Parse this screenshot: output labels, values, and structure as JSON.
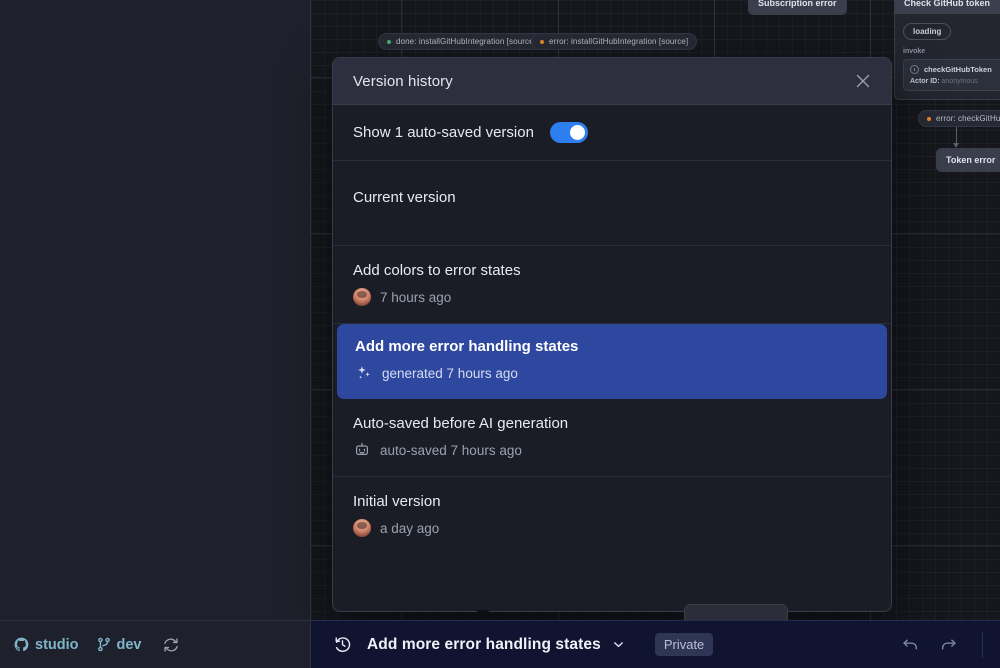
{
  "canvas": {
    "edge_pills": [
      {
        "label": "done:  installGitHubIntegration [source]",
        "status": "done"
      },
      {
        "label": "error:  installGitHubIntegration [source]",
        "status": "error"
      },
      {
        "label": "error:  checkGitHubToken",
        "status": "error"
      }
    ],
    "nodes": [
      {
        "title": "Subscription error"
      },
      {
        "title": "Check GitHub token",
        "state_chip": "loading",
        "invoke_label": "invoke",
        "invoke_name": "checkGitHubToken",
        "actor_key": "Actor ID:",
        "actor_value": "anonymous"
      },
      {
        "title": "Token error"
      }
    ]
  },
  "modal": {
    "title": "Version history",
    "close_icon": "close-icon",
    "toggle": {
      "label": "Show 1 auto-saved version",
      "enabled": true,
      "accent_color": "#2d7ff0"
    },
    "highlight_color": "#2e489f",
    "versions": [
      {
        "title": "Current version",
        "meta": "",
        "icon": "none",
        "selected": false
      },
      {
        "title": "Add colors to error states",
        "meta": "7 hours ago",
        "icon": "user-avatar",
        "selected": false
      },
      {
        "title": "Add more error handling states",
        "meta": "generated 7 hours ago",
        "icon": "sparkles-icon",
        "selected": true
      },
      {
        "title": "Auto-saved before AI generation",
        "meta": "auto-saved 7 hours ago",
        "icon": "robot-icon",
        "selected": false
      },
      {
        "title": "Initial version",
        "meta": "a day ago",
        "icon": "user-avatar",
        "selected": false
      }
    ]
  },
  "bottombar": {
    "repo": {
      "label": "studio",
      "icon": "github-icon"
    },
    "branch": {
      "label": "dev",
      "icon": "branch-icon"
    },
    "sync": {
      "icon": "refresh-icon"
    },
    "history": {
      "icon": "history-icon"
    },
    "document_title": "Add more error handling states",
    "chevron": "chevron-down-icon",
    "visibility_badge": "Private",
    "undo": {
      "icon": "undo-icon"
    },
    "redo": {
      "icon": "redo-icon"
    }
  }
}
